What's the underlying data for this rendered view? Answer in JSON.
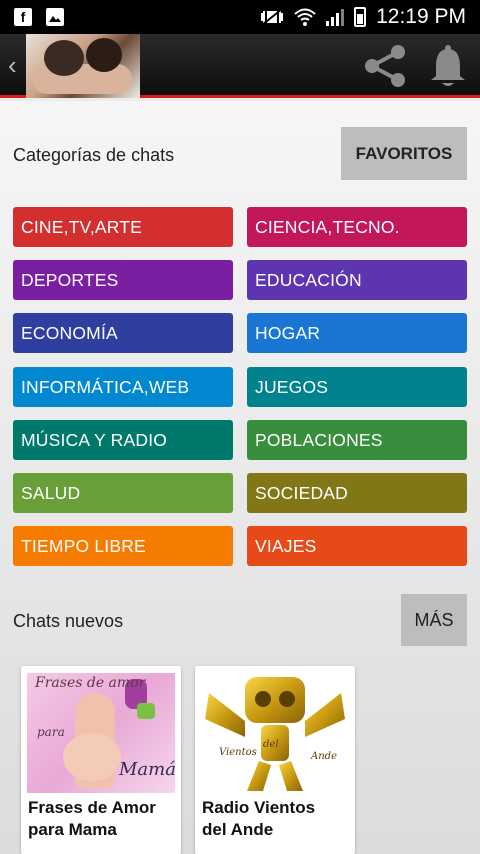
{
  "status_bar": {
    "time": "12:19 PM"
  },
  "categories_header": {
    "title": "Categorías de chats",
    "favorites_label": "FAVORITOS"
  },
  "categories": [
    {
      "label": "CINE,TV,ARTE",
      "color": "#d32f2f"
    },
    {
      "label": "CIENCIA,TECNO.",
      "color": "#c2185b"
    },
    {
      "label": "DEPORTES",
      "color": "#7b1fa2"
    },
    {
      "label": "EDUCACIÓN",
      "color": "#5e35b1"
    },
    {
      "label": "ECONOMÍA",
      "color": "#303f9f"
    },
    {
      "label": "HOGAR",
      "color": "#1976d2"
    },
    {
      "label": "INFORMÁTICA,WEB",
      "color": "#0288d1"
    },
    {
      "label": "JUEGOS",
      "color": "#00838f"
    },
    {
      "label": "MÚSICA Y RADIO",
      "color": "#00796b"
    },
    {
      "label": "POBLACIONES",
      "color": "#388e3c"
    },
    {
      "label": "SALUD",
      "color": "#689f38"
    },
    {
      "label": "SOCIEDAD",
      "color": "#827717"
    },
    {
      "label": "TIEMPO LIBRE",
      "color": "#f57c00"
    },
    {
      "label": "VIAJES",
      "color": "#e64a19"
    }
  ],
  "new_chats": {
    "title": "Chats nuevos",
    "more_label": "MÁS",
    "items": [
      {
        "title_line1": "Frases de Amor",
        "title_line2": "para Mama",
        "image_text": {
          "top": "Frases de amor",
          "middle": "para",
          "bottom": "Mamá"
        }
      },
      {
        "title_line1": "Radio Vientos",
        "title_line2": "del Ande",
        "image_text": {
          "top": "Vientos",
          "middle": "del",
          "bottom": "Ande"
        }
      }
    ]
  }
}
